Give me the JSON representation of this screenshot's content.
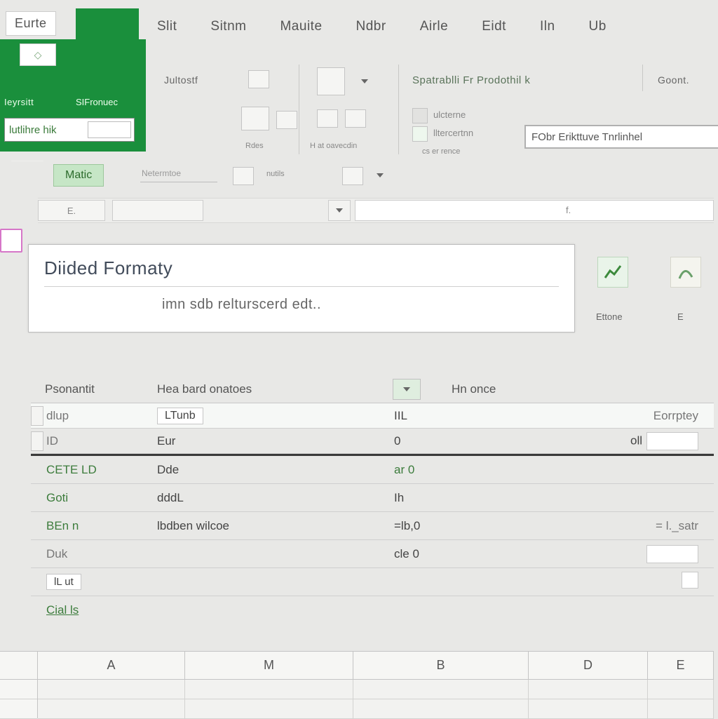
{
  "menu": {
    "items": [
      "Eurte",
      "Slit",
      "Sitnm",
      "Mauite",
      "Ndbr",
      "Airle",
      "Eidt",
      "Iln",
      "Ub"
    ]
  },
  "logo": {
    "qa_glyph": "◇",
    "label_left": "Ieyrsitt",
    "label_right": "SIFronuec",
    "input_label": "lutlihre hik",
    "matic": "Matic",
    "tinybar": "Netermtoe"
  },
  "ribbon": {
    "group1_label": "Jultostf",
    "group1_cap": "Rdes",
    "group2_cap": "H at oavecdin",
    "group3_top": "Spatrablli  Fr Prodothil k",
    "group3_mid1": "ulcterne",
    "group3_mid2": "lltercertnn",
    "group3_cap": "cs er rence",
    "group4_label": "Goont.",
    "big_input": "FObr Erikttuve Tnrlinhel",
    "tinybar": "nutils"
  },
  "formula_row": {
    "namebox": "E.",
    "fx_placeholder": "f."
  },
  "banner": {
    "title": "Diided Formaty",
    "subtitle": "imn sdb relturscerd edt.."
  },
  "side_icons": {
    "a_cap": "Ettone",
    "b_cap": "E"
  },
  "table": {
    "headers": {
      "h1": "Psonantit",
      "h2": "Hea  bard onatoes",
      "h3": "Hn once"
    },
    "rows": [
      {
        "c1": "dlup",
        "c2": "LTunb",
        "c3": "IIL",
        "c5": "Eorrptey"
      },
      {
        "c1": "ID",
        "c2": "Eur",
        "c3": "0",
        "c5": "oll"
      },
      {
        "c1": "CETE LD",
        "c2": "Dde",
        "c3": "ar 0",
        "c5": ""
      },
      {
        "c1": "Goti",
        "c2": "dddL",
        "c3": "Ih",
        "c5": ""
      },
      {
        "c1": "BEn n",
        "c2": "lbdben wilcoe",
        "c3": "=lb,0",
        "c5": "= l._satr"
      },
      {
        "c1": "Duk",
        "c2": "",
        "c3": "cle 0",
        "c5": ""
      },
      {
        "c1": "lL ut",
        "c2": "",
        "c3": "",
        "c5": ""
      },
      {
        "c1": "Cial ls",
        "c2": "",
        "c3": "",
        "c5": ""
      }
    ]
  },
  "sheet": {
    "cols": [
      "A",
      "M",
      "B",
      "D",
      "E"
    ]
  },
  "colors": {
    "brand_green": "#1a8f3c",
    "accent_green_light": "#c6e6c6",
    "pink": "#d676c8"
  }
}
